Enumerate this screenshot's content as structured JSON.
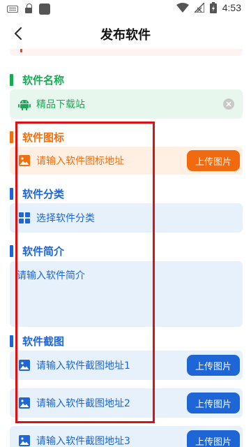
{
  "status_bar": {
    "time": "4:53"
  },
  "header": {
    "title": "发布软件"
  },
  "sections": {
    "name": {
      "title": "软件名称",
      "value": "精品下载站",
      "color": "#1aaa55",
      "field_bg": "#e8f7ee"
    },
    "icon": {
      "title": "软件图标",
      "placeholder": "请输入软件图标地址",
      "button": "上传图片",
      "color": "#f07010",
      "field_bg": "#fff0e3"
    },
    "category": {
      "title": "软件分类",
      "placeholder": "选择软件分类",
      "color": "#1e66d6",
      "field_bg": "#e6f1fc"
    },
    "intro": {
      "title": "软件简介",
      "placeholder": "请输入软件简介",
      "color": "#1e66d6",
      "field_bg": "#e6f1fc"
    },
    "screenshots": {
      "title": "软件截图",
      "color": "#1e66d6",
      "field_bg": "#e6f1fc",
      "button": "上传图片",
      "items": [
        {
          "placeholder": "请输入软件截图地址1"
        },
        {
          "placeholder": "请输入软件截图地址2"
        },
        {
          "placeholder": "请输入软件截图地址3"
        }
      ]
    }
  },
  "accent_colors": {
    "highlight_box": "#dd1111",
    "blue_button": "#1e66d6",
    "orange_button": "#f26a10"
  }
}
